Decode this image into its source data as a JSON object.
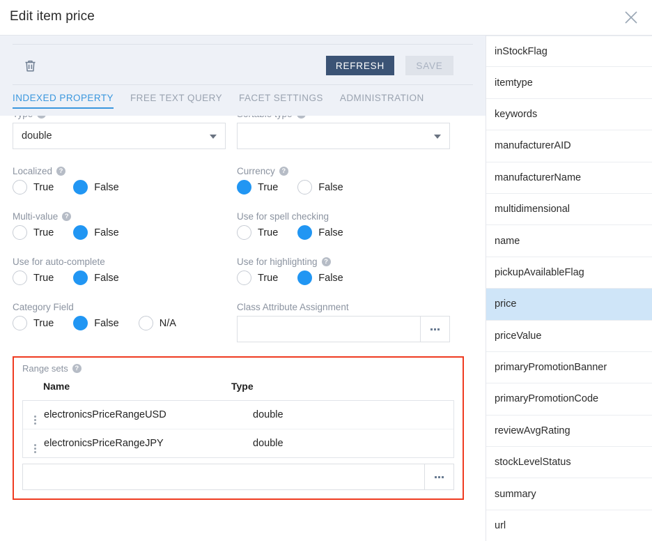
{
  "window": {
    "title": "Edit item price",
    "close_icon": "close-icon"
  },
  "toolbar": {
    "delete_icon": "trash-icon",
    "refresh_label": "REFRESH",
    "save_label": "SAVE"
  },
  "tabs": [
    {
      "label": "INDEXED PROPERTY",
      "active": true
    },
    {
      "label": "FREE TEXT QUERY",
      "active": false
    },
    {
      "label": "FACET SETTINGS",
      "active": false
    },
    {
      "label": "ADMINISTRATION",
      "active": false
    }
  ],
  "form": {
    "type": {
      "label": "Type",
      "help": "?",
      "value": "double"
    },
    "sortable_type": {
      "label": "Sortable type",
      "help": "?",
      "value": ""
    },
    "localized": {
      "label": "Localized",
      "help": "?",
      "options": [
        "True",
        "False"
      ],
      "selected": "False"
    },
    "currency": {
      "label": "Currency",
      "help": "?",
      "options": [
        "True",
        "False"
      ],
      "selected": "True"
    },
    "multi_value": {
      "label": "Multi-value",
      "help": "?",
      "options": [
        "True",
        "False"
      ],
      "selected": "False"
    },
    "spell_checking": {
      "label": "Use for spell checking",
      "options": [
        "True",
        "False"
      ],
      "selected": "False"
    },
    "auto_complete": {
      "label": "Use for auto-complete",
      "options": [
        "True",
        "False"
      ],
      "selected": "False"
    },
    "highlighting": {
      "label": "Use for highlighting",
      "help": "?",
      "options": [
        "True",
        "False"
      ],
      "selected": "False"
    },
    "category_field": {
      "label": "Category Field",
      "options": [
        "True",
        "False",
        "N/A"
      ],
      "selected": "False"
    },
    "class_attribute_assignment": {
      "label": "Class Attribute Assignment",
      "value": "",
      "placeholder": "",
      "browse_icon": "ellipsis-icon"
    }
  },
  "range_sets": {
    "label": "Range sets",
    "help": "?",
    "columns": [
      "Name",
      "Type"
    ],
    "rows": [
      {
        "name": "electronicsPriceRangeUSD",
        "type": "double"
      },
      {
        "name": "electronicsPriceRangeJPY",
        "type": "double"
      }
    ],
    "add_input": {
      "value": "",
      "placeholder": "",
      "browse_icon": "ellipsis-icon"
    },
    "highlight_color": "#ef3b21"
  },
  "sidebar": {
    "items": [
      {
        "label": "inStockFlag",
        "selected": false
      },
      {
        "label": "itemtype",
        "selected": false
      },
      {
        "label": "keywords",
        "selected": false
      },
      {
        "label": "manufacturerAID",
        "selected": false
      },
      {
        "label": "manufacturerName",
        "selected": false
      },
      {
        "label": "multidimensional",
        "selected": false
      },
      {
        "label": "name",
        "selected": false
      },
      {
        "label": "pickupAvailableFlag",
        "selected": false
      },
      {
        "label": "price",
        "selected": true
      },
      {
        "label": "priceValue",
        "selected": false
      },
      {
        "label": "primaryPromotionBanner",
        "selected": false
      },
      {
        "label": "primaryPromotionCode",
        "selected": false
      },
      {
        "label": "reviewAvgRating",
        "selected": false
      },
      {
        "label": "stockLevelStatus",
        "selected": false
      },
      {
        "label": "summary",
        "selected": false
      },
      {
        "label": "url",
        "selected": false
      }
    ]
  },
  "colors": {
    "accent_blue": "#2196f3",
    "tab_active": "#3a97de",
    "refresh_bg": "#3b5375",
    "toolbar_bg": "#eef1f7",
    "selection_bg": "#cfe5f8",
    "warning_border": "#ef3b21"
  }
}
